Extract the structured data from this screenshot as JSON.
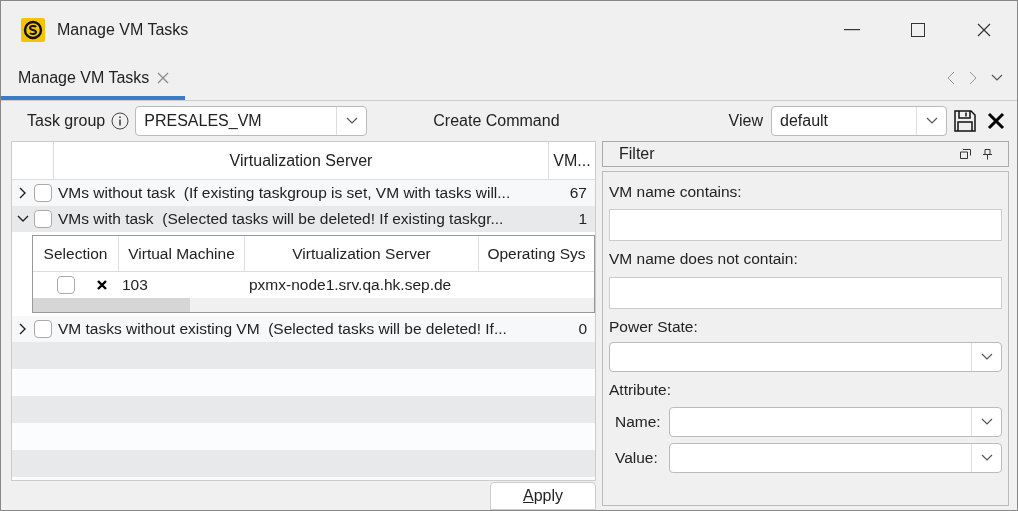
{
  "window": {
    "title": "Manage VM Tasks"
  },
  "tabs": [
    {
      "label": "Manage VM Tasks",
      "selected": true
    }
  ],
  "toolbar": {
    "task_group_label": "Task group",
    "task_group_value": "PRESALES_VM",
    "create_command": "Create Command",
    "view_label": "View",
    "view_value": "default"
  },
  "table": {
    "columns": [
      "Virtualization Server",
      "VM..."
    ],
    "groups": [
      {
        "label": "VMs without task  (If existing taskgroup is set, VM with tasks will...",
        "count": "67",
        "expanded": false,
        "checked": false,
        "selected": false
      },
      {
        "label": "VMs with task  (Selected tasks will be deleted! If existing taskgr...",
        "count": "1",
        "expanded": true,
        "checked": false,
        "selected": true,
        "subtable": {
          "columns": [
            "Selection",
            "Virtual Machine",
            "Virtualization Server",
            "Operating Sys"
          ],
          "rows": [
            {
              "checked": false,
              "vm": "103",
              "server": "pxmx-node1.srv.qa.hk.sep.de"
            }
          ]
        }
      },
      {
        "label": "VM tasks without existing VM  (Selected tasks will be deleted! If...",
        "count": "0",
        "expanded": false,
        "checked": false,
        "selected": false
      }
    ]
  },
  "apply_button": "Apply",
  "filter": {
    "title": "Filter",
    "name_contains_label": "VM name contains:",
    "name_not_contains_label": "VM name does not contain:",
    "power_state_label": "Power State:",
    "attribute_label": "Attribute:",
    "attribute_name_label": "Name:",
    "attribute_value_label": "Value:"
  }
}
